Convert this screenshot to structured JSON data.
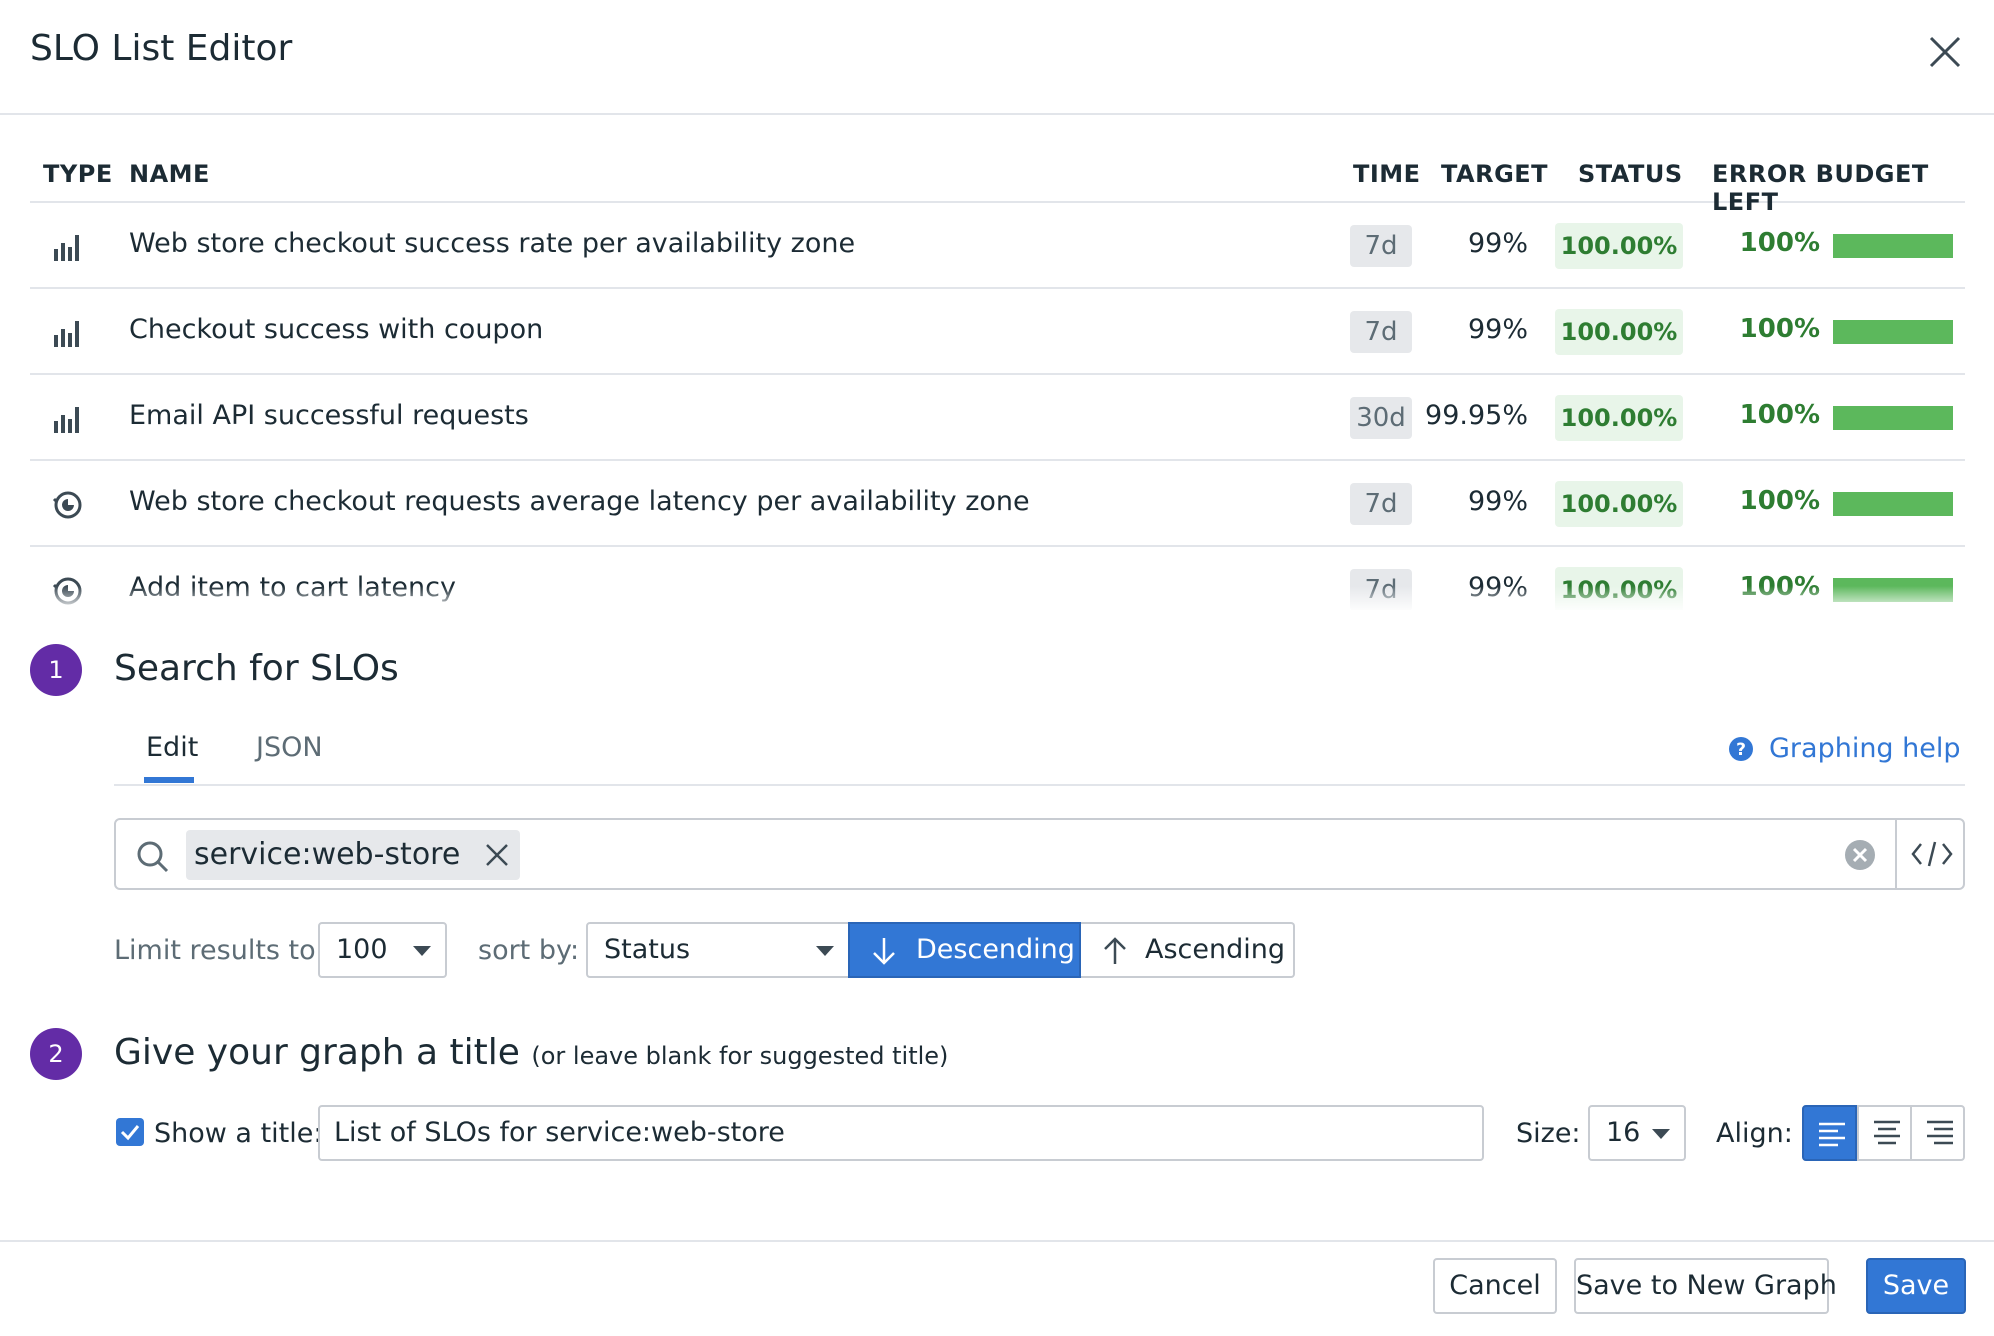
{
  "modal": {
    "title": "SLO List Editor"
  },
  "table": {
    "columns": {
      "type": "TYPE",
      "name": "NAME",
      "time": "TIME",
      "target": "TARGET",
      "status": "STATUS",
      "budget": "ERROR BUDGET LEFT"
    },
    "rows": [
      {
        "type_icon": "metric-bar-icon",
        "name": "Web store checkout success rate per availability zone",
        "time": "7d",
        "target": "99%",
        "status": "100.00%",
        "budget": "100%",
        "budget_fraction": 1.0
      },
      {
        "type_icon": "metric-bar-icon",
        "name": "Checkout success with coupon",
        "time": "7d",
        "target": "99%",
        "status": "100.00%",
        "budget": "100%",
        "budget_fraction": 1.0
      },
      {
        "type_icon": "metric-bar-icon",
        "name": "Email API successful requests",
        "time": "30d",
        "target": "99.95%",
        "status": "100.00%",
        "budget": "100%",
        "budget_fraction": 1.0
      },
      {
        "type_icon": "monitor-icon",
        "name": "Web store checkout requests average latency per availability zone",
        "time": "7d",
        "target": "99%",
        "status": "100.00%",
        "budget": "100%",
        "budget_fraction": 1.0
      },
      {
        "type_icon": "monitor-icon",
        "name": "Add item to cart latency",
        "time": "7d",
        "target": "99%",
        "status": "100.00%",
        "budget": "100%",
        "budget_fraction": 1.0
      }
    ]
  },
  "step1": {
    "number": "1",
    "title": "Search for SLOs",
    "tabs": {
      "edit": "Edit",
      "json": "JSON"
    },
    "help_link": "Graphing help",
    "search_chip": "service:web-store",
    "limit_label": "Limit results to:",
    "limit_value": "100",
    "sort_label": "sort by:",
    "sort_value": "Status",
    "descending": "Descending",
    "ascending": "Ascending"
  },
  "step2": {
    "number": "2",
    "title": "Give your graph a title",
    "subtitle": "(or leave blank for suggested title)",
    "show_title_label": "Show a title:",
    "show_title_checked": true,
    "title_value": "List of SLOs for service:web-store",
    "size_label": "Size:",
    "size_value": "16",
    "align_label": "Align:",
    "align_selected": "left"
  },
  "footer": {
    "cancel": "Cancel",
    "save_new": "Save to New Graph",
    "save": "Save"
  },
  "colors": {
    "accent": "#3277d5",
    "step": "#632ca6",
    "success": "#2e7d32",
    "bar": "#5cb85c"
  }
}
